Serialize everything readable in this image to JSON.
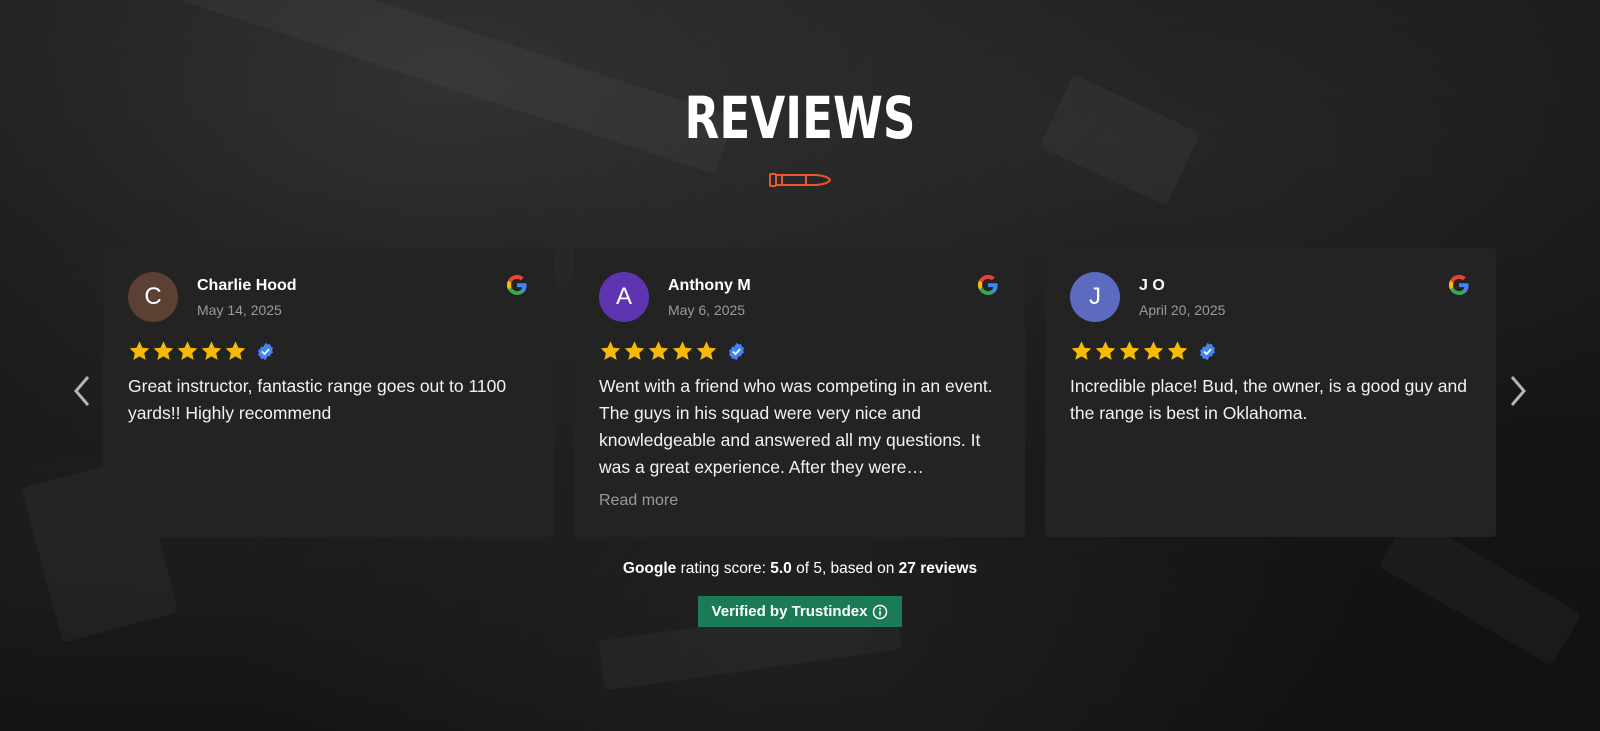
{
  "section": {
    "title": "REVIEWS"
  },
  "reviews": [
    {
      "initial": "C",
      "avatar_color": "#5c4033",
      "name": "Charlie Hood",
      "date": "May 14, 2025",
      "rating": 5,
      "text": "Great instructor, fantastic range goes out to 1100 yards!! Highly recommend",
      "read_more": ""
    },
    {
      "initial": "A",
      "avatar_color": "#5e35b1",
      "name": "Anthony M",
      "date": "May 6, 2025",
      "rating": 5,
      "text": "Went with a friend who was competing in an event. The guys in his squad were very nice and knowledgeable and answered all my questions. It was a great experience. After they were…",
      "read_more": "Read more"
    },
    {
      "initial": "J",
      "avatar_color": "#5c6bc0",
      "name": "J O",
      "date": "April 20, 2025",
      "rating": 5,
      "text": "Incredible place! Bud, the owner, is a good guy and the range is best in Oklahoma.",
      "read_more": ""
    }
  ],
  "summary": {
    "brand": "Google",
    "label": "rating score:",
    "score": "5.0",
    "of_text": "of 5, based on",
    "count_text": "27 reviews"
  },
  "badge": {
    "label": "Verified by Trustindex"
  },
  "colors": {
    "accent": "#e8582a",
    "star": "#f6bb06",
    "verified": "#4285f4",
    "badge": "#1b7b57",
    "card": "#232323"
  },
  "icons": {
    "prev": "chevron-left-icon",
    "next": "chevron-right-icon",
    "source": "google-icon",
    "divider": "bullet-icon"
  }
}
